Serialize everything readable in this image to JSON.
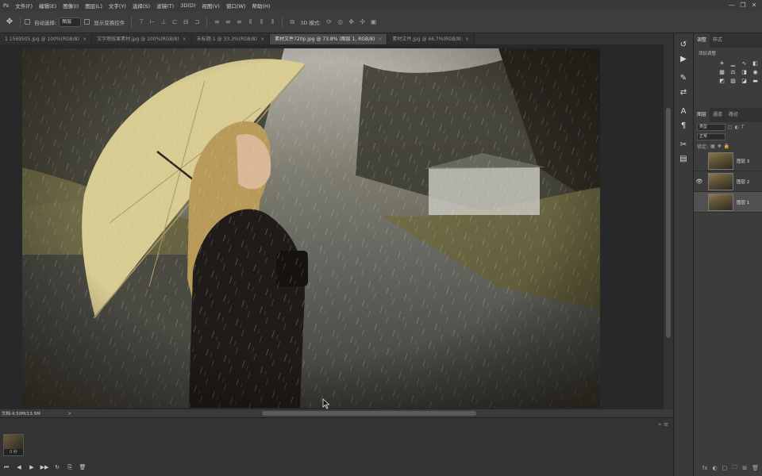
{
  "menubar": {
    "items": [
      "Ps",
      "文件(F)",
      "编辑(E)",
      "图像(I)",
      "图层(L)",
      "文字(Y)",
      "选择(S)",
      "滤镜(T)",
      "3D(D)",
      "视图(V)",
      "窗口(W)",
      "帮助(H)"
    ],
    "window_controls": [
      "—",
      "❐",
      "✕"
    ]
  },
  "options": {
    "auto_select_label": "自动选择:",
    "auto_select_value": "图层",
    "show_transform_label": "显示变换控件",
    "mode_label": "3D 模式:"
  },
  "tabs": [
    {
      "label": "1 1569505.jpg @ 100%(RGB/8)",
      "active": false
    },
    {
      "label": "文字雨效果素材.jpg @ 100%(RGB/8)",
      "active": false
    },
    {
      "label": "未标题-1 @ 33.3%(RGB/8)",
      "active": false
    },
    {
      "label": "素材文件720p.jpg @ 73.8% (图层 1, RGB/8)",
      "active": true
    },
    {
      "label": "素材文件.jpg @ 66.7%(RGB/8)",
      "active": false
    }
  ],
  "tab_close": "×",
  "status": {
    "doc_info": "文档:4.50M/13.5M",
    "arrow": ">"
  },
  "timeline": {
    "frame_duration": "0 秒",
    "controls": [
      "⏮",
      "◀",
      "▶",
      "▶▶",
      "↻",
      "⎘",
      "🗑"
    ]
  },
  "panels": {
    "adjust_tabs": [
      "调整",
      "样式"
    ],
    "adjust_label": "添加调整",
    "layers_tabs": [
      "图层",
      "通道",
      "路径"
    ],
    "kind_label": "类型",
    "normal_label": "正常",
    "lock_label": "锁定:",
    "layers": [
      {
        "name": "图层 3",
        "visible": false,
        "selected": false
      },
      {
        "name": "图层 2",
        "visible": true,
        "selected": false
      },
      {
        "name": "图层 1",
        "visible": false,
        "selected": true
      }
    ],
    "bottom_icons": [
      "fx",
      "◐",
      "▢",
      "🗀",
      "⊞",
      "🗑"
    ]
  }
}
